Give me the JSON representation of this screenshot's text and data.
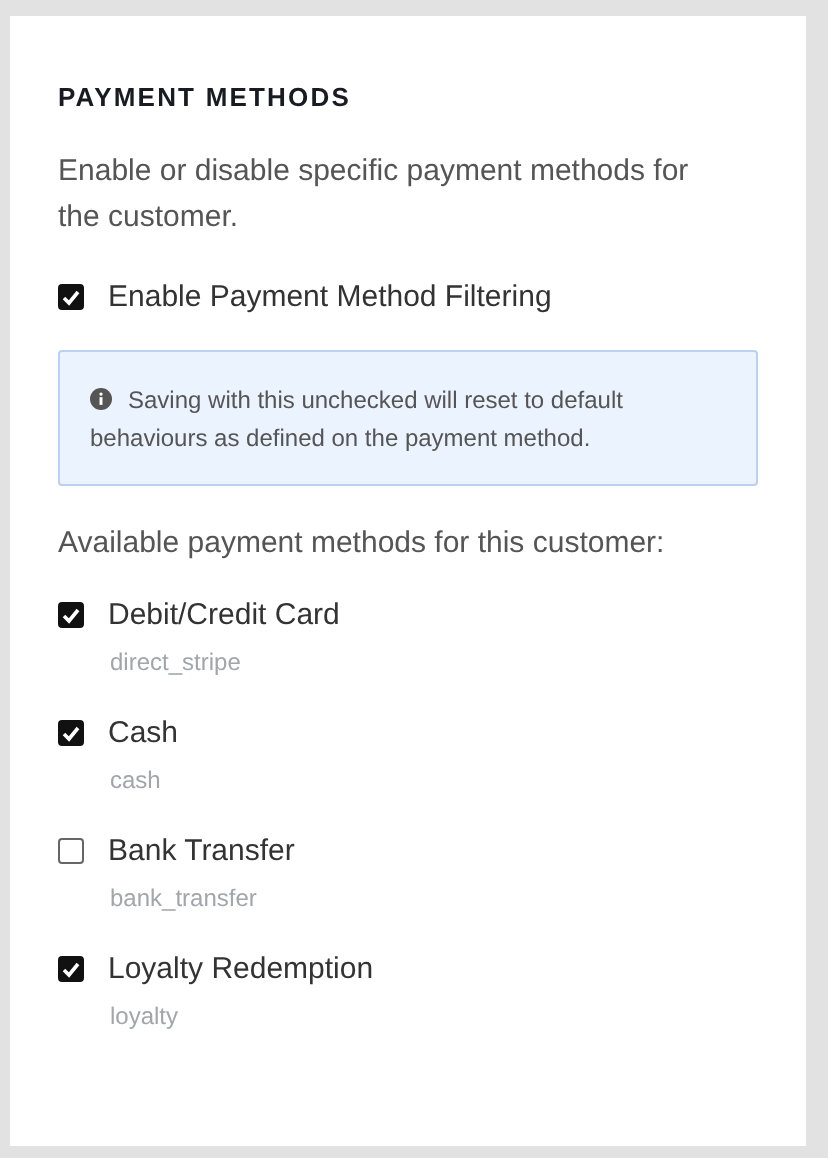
{
  "title": "PAYMENT METHODS",
  "description": "Enable or disable specific payment methods for the customer.",
  "filter": {
    "label": "Enable Payment Method Filtering",
    "checked": true
  },
  "notice": "Saving with this unchecked will reset to default behaviours as defined on the payment method.",
  "methods_label": "Available payment methods for this customer:",
  "methods": [
    {
      "label": "Debit/Credit Card",
      "code": "direct_stripe",
      "checked": true
    },
    {
      "label": "Cash",
      "code": "cash",
      "checked": true
    },
    {
      "label": "Bank Transfer",
      "code": "bank_transfer",
      "checked": false
    },
    {
      "label": "Loyalty Redemption",
      "code": "loyalty",
      "checked": true
    }
  ]
}
